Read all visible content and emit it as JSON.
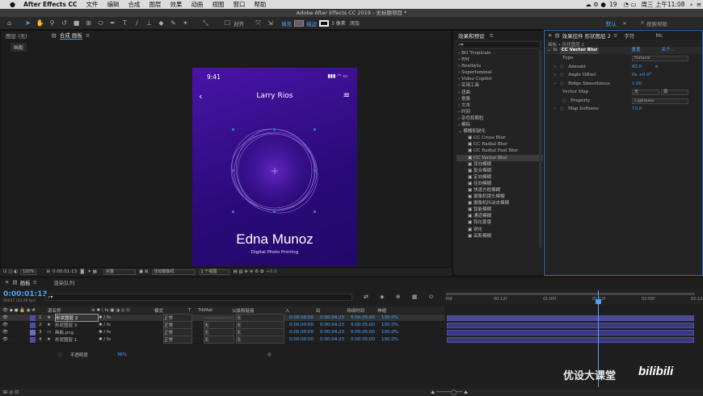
{
  "menubar": {
    "apple": "",
    "app": "After Effects CC",
    "items": [
      "文件",
      "编辑",
      "合成",
      "图层",
      "效果",
      "动画",
      "视图",
      "窗口",
      "帮助"
    ],
    "badge": "19",
    "clock": "周三 上午11:08"
  },
  "title": "Adobe After Effects CC 2019 - 无标题项目 *",
  "toolbar": {
    "align": "对齐",
    "fill": "填充",
    "stroke": "描边",
    "stroke_px": "3 像素",
    "add": "添加",
    "workspace": "默认",
    "search": "搜索帮助"
  },
  "left": {
    "layer_tab": "图层 (无)",
    "comp_tab": "合成 画板",
    "sub_tab": "画板"
  },
  "phone": {
    "time": "9:41",
    "name": "Larry Rios",
    "big_name": "Edna Munoz",
    "subtitle": "Digital Photo Printing"
  },
  "viewer": {
    "zoom": "100%",
    "timecode": "0:00:01:13",
    "quality": "完整",
    "camera": "活动摄像机",
    "views": "1 个视图",
    "exposure": "+0.0"
  },
  "effects": {
    "tab": "效果和预设",
    "items": [
      "BG Tropicale",
      "RM",
      "Rowbyte",
      "Superluminal",
      "Video Copilot",
      "实用工具",
      "扭曲",
      "抠像",
      "文本",
      "时间",
      "杂色和颗粒",
      "模拟",
      "模糊和锐化",
      "CC Cross Blur",
      "CC Radial Blur",
      "CC Radial Fast Blur",
      "CC Vector Blur",
      "双向模糊",
      "复合模糊",
      "定向模糊",
      "径向模糊",
      "快速方框模糊",
      "摄像机镜头模糊",
      "摄像机抖动去模糊",
      "智能模糊",
      "通道模糊",
      "钝化蒙版",
      "锐化",
      "高斯模糊"
    ]
  },
  "effect_controls": {
    "tab": "效果控件 形状图层 2",
    "tab2": "字符",
    "tab3": "Mc",
    "breadcrumb": "画板 • 形状图层 2",
    "effect": "CC Vector Blur",
    "reset": "重置",
    "about": "关于...",
    "rows": [
      {
        "label": "Type",
        "value": "Natural"
      },
      {
        "label": "Amount",
        "value": "65.0"
      },
      {
        "label": "Angle Offset",
        "value": "0x +0.0°"
      },
      {
        "label": "Ridge Smoothness",
        "value": "1.00"
      },
      {
        "label": "Vector Map",
        "value": "无",
        "value2": "源"
      },
      {
        "label": "Property",
        "value": "Lightness"
      },
      {
        "label": "Map Softness",
        "value": "15.0"
      }
    ]
  },
  "timeline": {
    "tab": "画板",
    "tab2": "渲染队列",
    "timecode": "0:00:01:13",
    "fps": "00037 (24.00 fps)",
    "cols": [
      "源名称",
      "模式",
      "T",
      "TrkMat",
      "父级和链接",
      "入",
      "出",
      "持续时间",
      "伸缩"
    ],
    "ruler": [
      ":00f",
      "00:12f",
      "01:00f",
      "01:12f",
      "02:00f",
      "02:12f"
    ],
    "layers": [
      {
        "n": "1",
        "name": "形状图层 2",
        "mode": "正常",
        "trk": "",
        "parent": "无",
        "in": "0:00:00:00",
        "out": "0:00:04:23",
        "dur": "0:00:05:00",
        "str": "100.0%"
      },
      {
        "n": "2",
        "name": "形状图层 3",
        "mode": "正常",
        "trk": "无",
        "parent": "无",
        "in": "0:00:00:00",
        "out": "0:00:04:23",
        "dur": "0:00:05:00",
        "str": "100.0%"
      },
      {
        "n": "3",
        "name": "画板.png",
        "mode": "正常",
        "trk": "无",
        "parent": "无",
        "in": "0:00:00:00",
        "out": "0:00:04:23",
        "dur": "0:00:05:00",
        "str": "100.0%"
      },
      {
        "n": "4",
        "name": "形状图层 1",
        "mode": "正常",
        "trk": "无",
        "parent": "无",
        "in": "0:00:00:00",
        "out": "0:00:04:23",
        "dur": "0:00:05:00",
        "str": "100.0%"
      }
    ],
    "opacity_label": "不透明度",
    "opacity_value": "36%"
  },
  "watermark": {
    "cn": "优设大课堂",
    "logo": "bilibili"
  },
  "colors": {
    "accent": "#4ba3ff",
    "purple": "#3a0d96"
  }
}
